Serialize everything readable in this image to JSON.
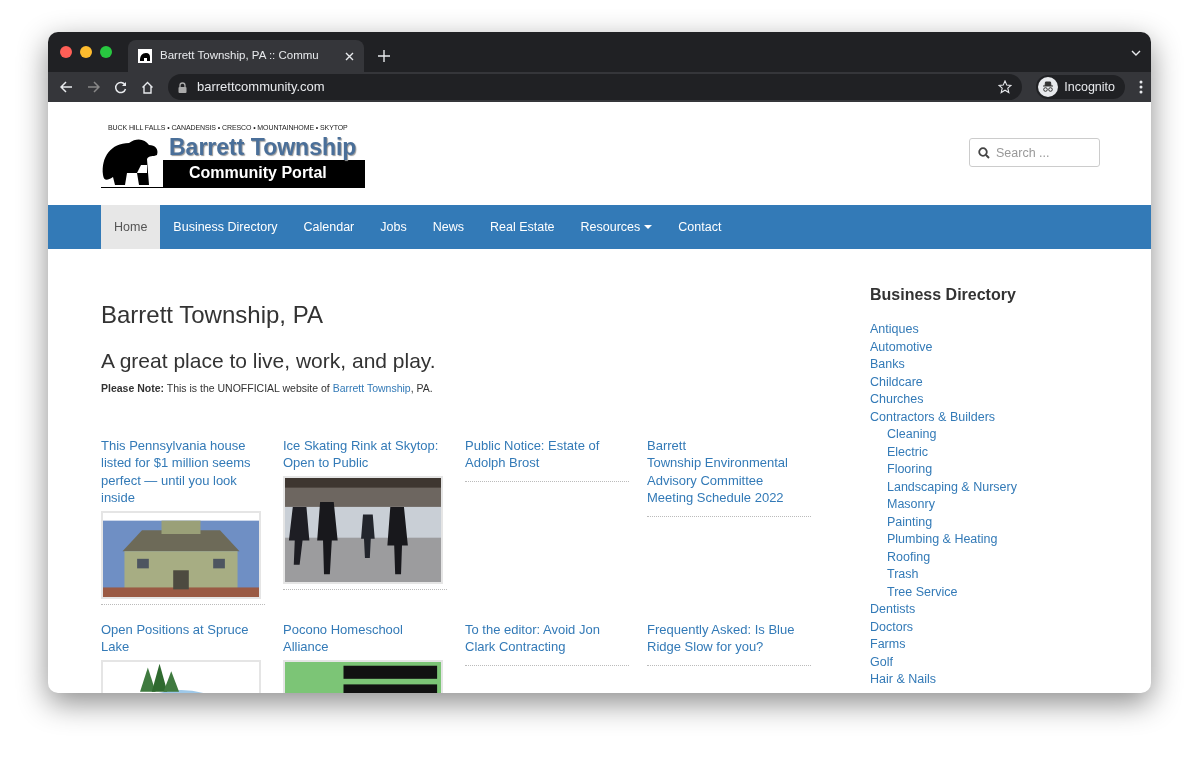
{
  "browser": {
    "tab_title": "Barrett Township, PA :: Commu",
    "url": "barrettcommunity.com",
    "profile": "Incognito"
  },
  "header": {
    "tagline": "BUCK HILL FALLS • CANADENSIS • CRESCO • MOUNTAINHOME • SKYTOP",
    "logo_title": "Barrett Township",
    "logo_subtitle": "Community Portal",
    "search": {
      "placeholder": "Search ..."
    }
  },
  "nav": [
    {
      "label": "Home",
      "selected": true
    },
    {
      "label": "Business Directory",
      "selected": false
    },
    {
      "label": "Calendar",
      "selected": false
    },
    {
      "label": "Jobs",
      "selected": false
    },
    {
      "label": "News",
      "selected": false
    },
    {
      "label": "Real Estate",
      "selected": false
    },
    {
      "label": "Resources",
      "selected": false,
      "has_menu": true
    },
    {
      "label": "Contact",
      "selected": false
    }
  ],
  "main": {
    "title": "Barrett Township, PA",
    "subtitle": "A great place to live, work, and play.",
    "note": {
      "label": "Please Note:",
      "text": " This is the UNOFFICIAL website of ",
      "link": "Barrett Township",
      "after": ", PA."
    }
  },
  "articles": [
    {
      "title": "This Pennsylvania house listed for $1 million seems perfect — until you look inside"
    },
    {
      "title": "Ice Skating Rink at Skytop: Open to Public"
    },
    {
      "title": "Public Notice: Estate of Adolph Brost"
    },
    {
      "title": "Barrett\nTownship Environmental Advisory Committee Meeting Schedule 2022"
    },
    {
      "title": "Open Positions at Spruce Lake"
    },
    {
      "title": "Pocono Homeschool Alliance"
    },
    {
      "title": "To the editor: Avoid Jon Clark Contracting"
    },
    {
      "title": "Frequently Asked: Is Blue Ridge Slow for you?"
    }
  ],
  "sidebar": {
    "heading": "Business Directory",
    "items": [
      {
        "label": "Antiques"
      },
      {
        "label": "Automotive"
      },
      {
        "label": "Banks"
      },
      {
        "label": "Childcare"
      },
      {
        "label": "Churches"
      },
      {
        "label": "Contractors & Builders",
        "children": [
          {
            "label": "Cleaning"
          },
          {
            "label": "Electric"
          },
          {
            "label": "Flooring"
          },
          {
            "label": "Landscaping & Nursery"
          },
          {
            "label": "Masonry"
          },
          {
            "label": "Painting"
          },
          {
            "label": "Plumbing & Heating"
          },
          {
            "label": "Roofing"
          },
          {
            "label": "Trash"
          },
          {
            "label": "Tree Service"
          }
        ]
      },
      {
        "label": "Dentists"
      },
      {
        "label": "Doctors"
      },
      {
        "label": "Farms"
      },
      {
        "label": "Golf"
      },
      {
        "label": "Hair & Nails"
      }
    ]
  }
}
